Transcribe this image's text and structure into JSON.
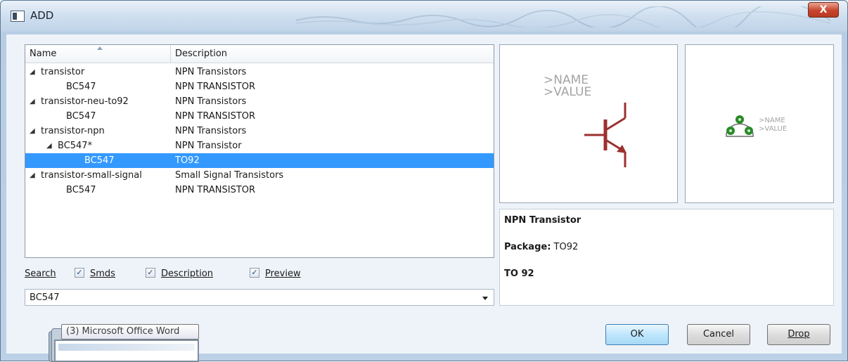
{
  "window": {
    "title": "ADD",
    "close_glyph": "X"
  },
  "tree": {
    "columns": {
      "name": "Name",
      "description": "Description"
    },
    "rows": [
      {
        "name": "transistor",
        "description": "NPN Transistors",
        "level": 0,
        "expanded": true
      },
      {
        "name": "BC547",
        "description": "NPN TRANSISTOR",
        "level": 1,
        "expanded": false
      },
      {
        "name": "transistor-neu-to92",
        "description": "NPN Transistors",
        "level": 0,
        "expanded": true
      },
      {
        "name": "BC547",
        "description": "NPN TRANSISTOR",
        "level": 1,
        "expanded": false
      },
      {
        "name": "transistor-npn",
        "description": "NPN Transistors",
        "level": 0,
        "expanded": true
      },
      {
        "name": "BC547*",
        "description": "NPN Transistor",
        "level": 1,
        "expanded": true
      },
      {
        "name": "BC547",
        "description": "TO92",
        "level": 2,
        "expanded": false,
        "selected": true
      },
      {
        "name": "transistor-small-signal",
        "description": "Small Signal Transistors",
        "level": 0,
        "expanded": true
      },
      {
        "name": "BC547",
        "description": "NPN TRANSISTOR",
        "level": 1,
        "expanded": false
      }
    ],
    "expander_glyph": "◢"
  },
  "search": {
    "label": "Search",
    "smds": {
      "label": "Smds",
      "checked": true
    },
    "description": {
      "label": "Description",
      "checked": true
    },
    "preview": {
      "label": "Preview",
      "checked": true
    },
    "value": "BC547"
  },
  "preview": {
    "symbol_text": ">NAME\n>VALUE",
    "package_text": ">NAME\n>VALUE",
    "symbol_color": "#9c3030",
    "pad_color": "#2a8a2a"
  },
  "info": {
    "title": "NPN Transistor",
    "package_label": "Package:",
    "package_value": "TO92",
    "footer": "TO 92"
  },
  "buttons": {
    "ok": "OK",
    "cancel": "Cancel",
    "drop": "Drop"
  },
  "taskbar_tooltip": "(3) Microsoft Office Word",
  "colors": {
    "selection": "#3399ff",
    "close": "#c7452c"
  }
}
